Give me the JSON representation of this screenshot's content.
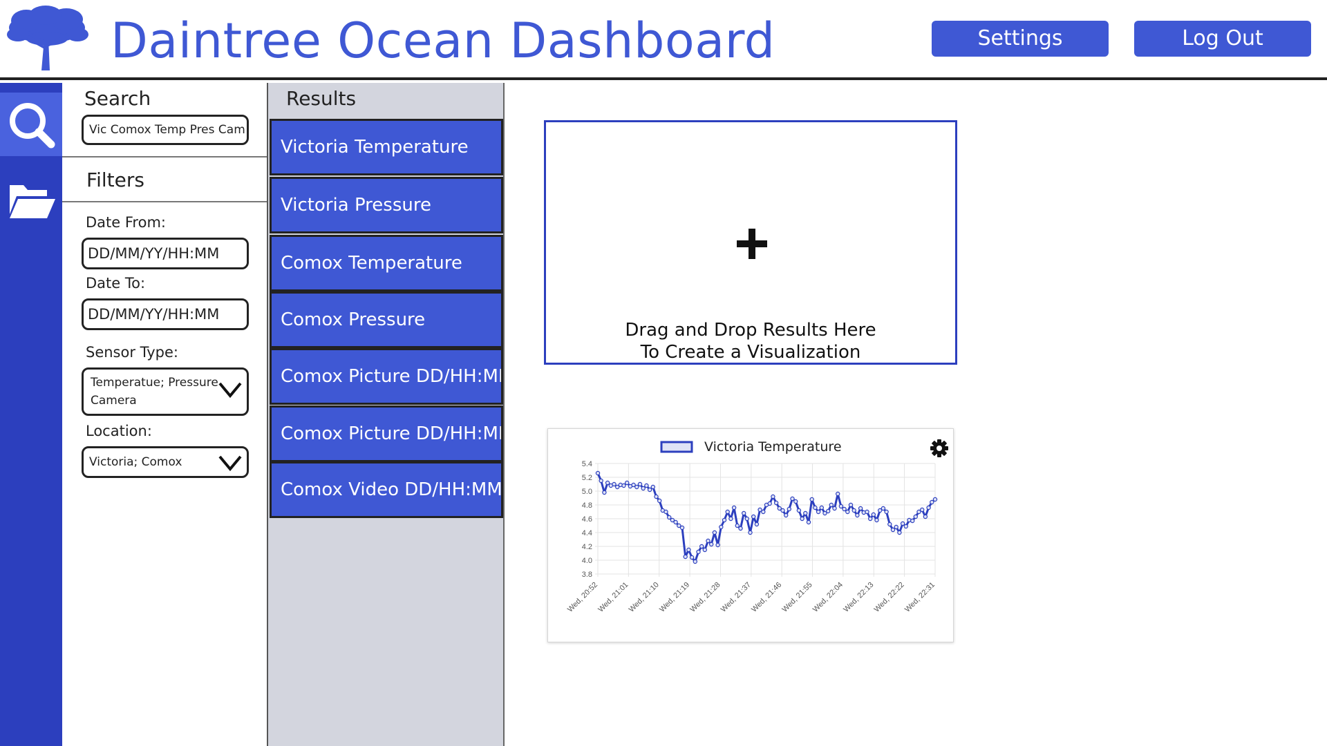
{
  "header": {
    "title": "Daintree Ocean Dashboard",
    "settings_label": "Settings",
    "logout_label": "Log Out"
  },
  "rail": {
    "icons": [
      "search-icon",
      "folder-open-icon"
    ],
    "active": "search"
  },
  "search": {
    "heading": "Search",
    "value": "Vic Comox Temp Pres Cam"
  },
  "filters": {
    "heading": "Filters",
    "date_from_label": "Date From:",
    "date_from_value": "DD/MM/YY/HH:MM",
    "date_to_label": "Date To:",
    "date_to_value": "DD/MM/YY/HH:MM",
    "sensor_label": "Sensor Type:",
    "sensor_line1": "Temperatue; Pressure",
    "sensor_line2": "Camera",
    "location_label": "Location:",
    "location_value": "Victoria; Comox"
  },
  "results": {
    "heading": "Results",
    "items": [
      "Victoria Temperature",
      "Victoria Pressure",
      "Comox Temperature",
      "Comox Pressure",
      "Comox Picture DD/HH:MM",
      "Comox Picture DD/HH:MM",
      "Comox Video DD/HH:MM"
    ]
  },
  "drop_zone": {
    "line1": "Drag and Drop Results Here",
    "line2": "To Create a Visualization"
  },
  "colors": {
    "brand": "#3f58d4",
    "rail": "#2c3fbe",
    "series": "#2c3fbe"
  },
  "chart_data": {
    "type": "line",
    "legend": "Victoria Temperature",
    "legend_position": "top",
    "grid": true,
    "ylim": [
      3.8,
      5.4
    ],
    "yticks": [
      "5.4",
      "5.2",
      "5.0",
      "4.8",
      "4.6",
      "4.4",
      "4.2",
      "4.0",
      "3.8"
    ],
    "xticks": [
      "Wed, 20:52",
      "Wed, 21:01",
      "Wed, 21:10",
      "Wed, 21:19",
      "Wed, 21:28",
      "Wed, 21:37",
      "Wed, 21:46",
      "Wed, 21:55",
      "Wed, 22:04",
      "Wed, 22:13",
      "Wed, 22:22",
      "Wed, 22:31"
    ],
    "series": [
      {
        "name": "Victoria Temperature",
        "values": [
          5.26,
          5.15,
          4.98,
          5.12,
          5.08,
          5.1,
          5.06,
          5.09,
          5.08,
          5.12,
          5.07,
          5.09,
          5.06,
          5.1,
          5.04,
          5.08,
          5.02,
          5.06,
          4.92,
          4.86,
          4.72,
          4.7,
          4.62,
          4.58,
          4.55,
          4.5,
          4.47,
          4.05,
          4.15,
          4.04,
          3.98,
          4.12,
          4.2,
          4.15,
          4.28,
          4.23,
          4.4,
          4.22,
          4.48,
          4.58,
          4.7,
          4.6,
          4.76,
          4.5,
          4.46,
          4.68,
          4.6,
          4.4,
          4.63,
          4.52,
          4.73,
          4.7,
          4.8,
          4.82,
          4.92,
          4.83,
          4.75,
          4.72,
          4.65,
          4.74,
          4.89,
          4.85,
          4.72,
          4.6,
          4.68,
          4.55,
          4.88,
          4.76,
          4.7,
          4.76,
          4.68,
          4.71,
          4.8,
          4.75,
          4.96,
          4.78,
          4.74,
          4.7,
          4.8,
          4.72,
          4.65,
          4.75,
          4.69,
          4.7,
          4.6,
          4.66,
          4.58,
          4.72,
          4.75,
          4.7,
          4.52,
          4.44,
          4.48,
          4.4,
          4.53,
          4.49,
          4.58,
          4.57,
          4.63,
          4.7,
          4.73,
          4.63,
          4.76,
          4.84,
          4.88
        ]
      }
    ]
  }
}
